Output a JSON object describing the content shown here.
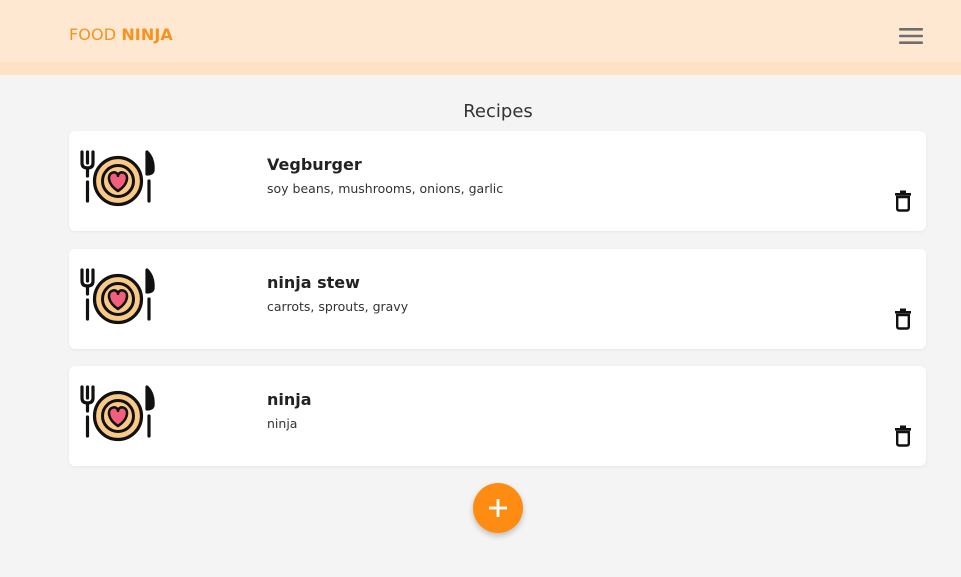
{
  "navbar": {
    "brand_light": "FOOD",
    "brand_bold": "NINJA",
    "menu_icon": "hamburger-menu-icon"
  },
  "main": {
    "title": "Recipes",
    "recipes": [
      {
        "title": "Vegburger",
        "ingredients": "soy beans, mushrooms, onions, garlic",
        "image_icon": "dish-heart-icon",
        "delete_icon": "trash-icon"
      },
      {
        "title": "ninja stew",
        "ingredients": "carrots, sprouts, gravy",
        "image_icon": "dish-heart-icon",
        "delete_icon": "trash-icon"
      },
      {
        "title": "ninja",
        "ingredients": "ninja",
        "image_icon": "dish-heart-icon",
        "delete_icon": "trash-icon"
      }
    ],
    "add_button_icon": "plus-icon"
  },
  "colors": {
    "accent": "#ff8c12",
    "brand_text": "#f7921e",
    "navbar_bg": "#ffe8d2",
    "page_bg": "#f4f4f4",
    "plate_fill": "#f9c98a",
    "heart_fill": "#f25f7c"
  }
}
